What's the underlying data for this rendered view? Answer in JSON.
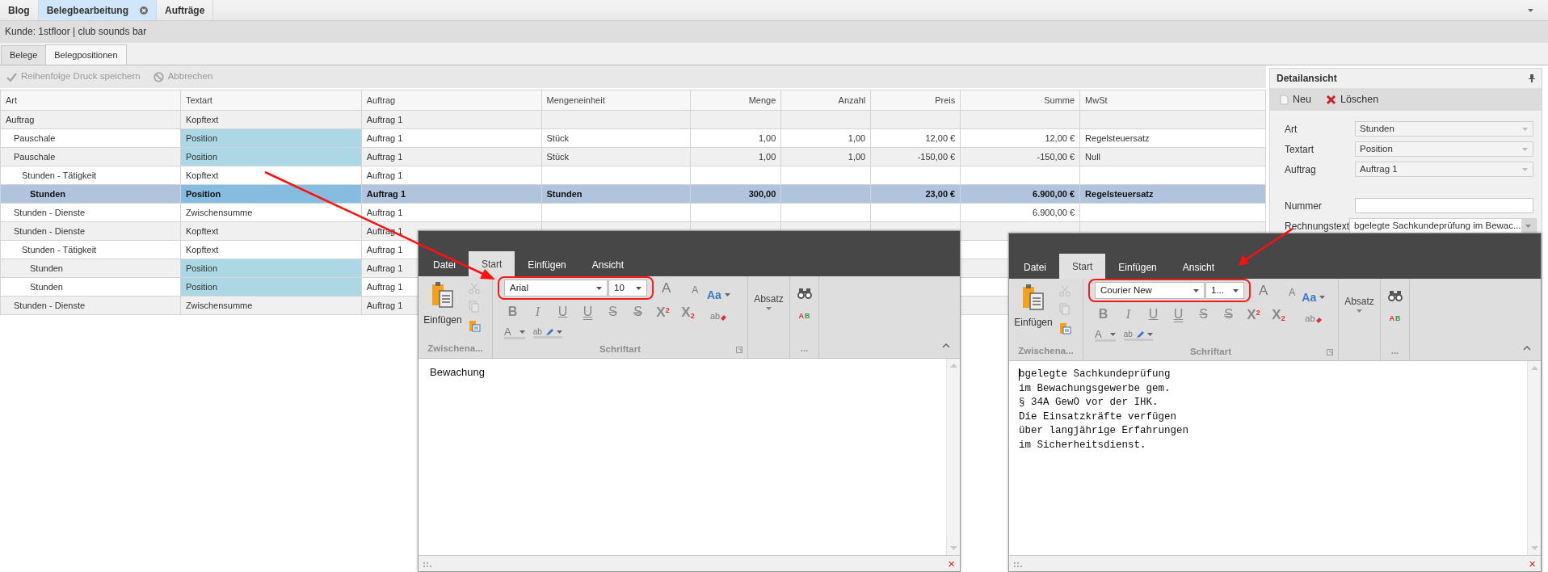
{
  "doc_tabs": [
    {
      "label": "Blog",
      "selected": false,
      "closable": false
    },
    {
      "label": "Belegbearbeitung",
      "selected": true,
      "closable": true
    },
    {
      "label": "Aufträge",
      "selected": false,
      "closable": false
    }
  ],
  "customer_bar": "Kunde: 1stfloor | club sounds bar",
  "sub_tabs": [
    {
      "label": "Belege",
      "selected": false
    },
    {
      "label": "Belegpositionen",
      "selected": true
    }
  ],
  "toolbar": [
    {
      "label": "Reihenfolge Druck speichern",
      "kind": "save",
      "disabled": true
    },
    {
      "label": "Abbrechen",
      "kind": "cancel",
      "disabled": true
    }
  ],
  "table": {
    "columns": [
      "Art",
      "Textart",
      "Auftrag",
      "Mengeneinheit",
      "Menge",
      "Anzahl",
      "Preis",
      "Summe",
      "MwSt"
    ],
    "rows": [
      {
        "cells": [
          "Auftrag",
          "Kopftext",
          "Auftrag 1"
        ],
        "selected": false,
        "highlight": false,
        "children": [
          {
            "cells": [
              "Pauschale",
              "Position",
              "Auftrag 1",
              "Stück",
              "1,00",
              "1,00",
              "12,00 €",
              "12,00 €",
              "Regelsteuersatz"
            ],
            "selected": false,
            "highlight": true
          },
          {
            "cells": [
              "Pauschale",
              "Position",
              "Auftrag 1",
              "Stück",
              "1,00",
              "1,00",
              "-150,00 €",
              "-150,00 €",
              "Null"
            ],
            "selected": false,
            "highlight": true,
            "children": [
              {
                "cells": [
                  "Stunden - Tätigkeit",
                  "Kopftext",
                  "Auftrag 1"
                ],
                "selected": false,
                "highlight": false,
                "children": [
                  {
                    "cells": [
                      "Stunden",
                      "Position",
                      "Auftrag 1",
                      "Stunden",
                      "300,00",
                      null,
                      "23,00 €",
                      "6.900,00 €",
                      "Regelsteuersatz"
                    ],
                    "selected": true,
                    "highlight": true
                  }
                ]
              }
            ]
          },
          {
            "cells": [
              "Stunden - Dienste",
              "Zwischensumme",
              "Auftrag 1",
              null,
              null,
              null,
              null,
              "6.900,00 €"
            ],
            "selected": false,
            "highlight": false
          },
          {
            "cells": [
              "Stunden - Dienste",
              "Kopftext",
              "Auftrag 1"
            ],
            "selected": false,
            "highlight": false,
            "children": [
              {
                "cells": [
                  "Stunden - Tätigkeit",
                  "Kopftext",
                  "Auftrag 1"
                ],
                "selected": false,
                "highlight": false,
                "children": [
                  {
                    "cells": [
                      "Stunden",
                      "Position",
                      "Auftrag 1"
                    ],
                    "selected": false,
                    "highlight": true
                  },
                  {
                    "cells": [
                      "Stunden",
                      "Position",
                      "Auftrag 1"
                    ],
                    "selected": false,
                    "highlight": true
                  }
                ]
              }
            ]
          },
          {
            "cells": [
              "Stunden - Dienste",
              "Zwischensumme",
              "Auftrag 1"
            ],
            "selected": false,
            "highlight": false
          }
        ]
      }
    ]
  },
  "detail_panel": {
    "title": "Detailansicht",
    "buttons": [
      {
        "label": "Neu",
        "kind": "new"
      },
      {
        "label": "Löschen",
        "kind": "delete"
      }
    ],
    "field_groups": [
      [
        {
          "label": "Art",
          "kind": "combo",
          "value": "Stunden"
        },
        {
          "label": "Textart",
          "kind": "combo",
          "value": "Position"
        },
        {
          "label": "Auftrag",
          "kind": "combo",
          "value": "Auftrag 1"
        }
      ],
      [
        {
          "label": "Nummer",
          "kind": "text"
        },
        {
          "label": "Rechnungstext",
          "kind": "combo-button",
          "value": "bgelegte Sachkundeprüfung im Bewac..."
        }
      ]
    ]
  },
  "editors": [
    {
      "tabs": [
        {
          "label": "Datei",
          "selected": false
        },
        {
          "label": "Start",
          "selected": true
        },
        {
          "label": "Einfügen",
          "selected": false
        },
        {
          "label": "Ansicht",
          "selected": false
        }
      ],
      "clipboard": {
        "paste_label": "Einfügen",
        "group_label": "Zwischena..."
      },
      "font_group": {
        "font": "Arial",
        "size": "10",
        "group_label": "Schriftart",
        "tools": [
          {
            "kind": "grow",
            "label": "A"
          },
          {
            "kind": "shrink",
            "label": "A"
          },
          {
            "kind": "case",
            "label": "Aa"
          },
          {
            "kind": "clear",
            "label": "ab"
          },
          {
            "kind": "font-color",
            "label": "A"
          },
          {
            "kind": "highlight",
            "label": "ab"
          }
        ],
        "format_buttons": [
          {
            "kind": "bold",
            "label": "B"
          },
          {
            "kind": "italic",
            "label": "I"
          },
          {
            "kind": "underline",
            "label": "U"
          },
          {
            "kind": "double-underline",
            "label": "U"
          },
          {
            "kind": "strike",
            "label": "S"
          },
          {
            "kind": "double-strike",
            "label": "S"
          },
          {
            "kind": "script",
            "label": "X$^{2}$"
          },
          {
            "kind": "script",
            "label": "X$_{2}$"
          }
        ]
      },
      "paragraph_label": "Absatz",
      "editing_group": {
        "group_label": "...",
        "spell_labels": [
          "A",
          "B"
        ]
      },
      "monospace": false,
      "lines": [
        "Bewachung"
      ],
      "caret": false,
      "close_glyph": "×"
    },
    {
      "tabs": [
        {
          "label": "Datei",
          "selected": false
        },
        {
          "label": "Start",
          "selected": true
        },
        {
          "label": "Einfügen",
          "selected": false
        },
        {
          "label": "Ansicht",
          "selected": false
        }
      ],
      "clipboard": {
        "paste_label": "Einfügen",
        "group_label": "Zwischena..."
      },
      "font_group": {
        "font": "Courier New",
        "size": "1...",
        "group_label": "Schriftart",
        "tools": [
          {
            "kind": "grow",
            "label": "A"
          },
          {
            "kind": "shrink",
            "label": "A"
          },
          {
            "kind": "case",
            "label": "Aa"
          },
          {
            "kind": "clear",
            "label": "ab"
          },
          {
            "kind": "font-color",
            "label": "A"
          },
          {
            "kind": "highlight",
            "label": "ab"
          }
        ],
        "format_buttons": [
          {
            "kind": "bold",
            "label": "B"
          },
          {
            "kind": "italic",
            "label": "I"
          },
          {
            "kind": "underline",
            "label": "U"
          },
          {
            "kind": "double-underline",
            "label": "U"
          },
          {
            "kind": "strike",
            "label": "S"
          },
          {
            "kind": "double-strike",
            "label": "S"
          },
          {
            "kind": "script",
            "label": "X$^{2}$"
          },
          {
            "kind": "script",
            "label": "X$_{2}$"
          }
        ]
      },
      "paragraph_label": "Absatz",
      "editing_group": {
        "group_label": "...",
        "spell_labels": [
          "A",
          "B"
        ]
      },
      "monospace": true,
      "lines": [
        "bgelegte Sachkundeprüfung",
        "im Bewachungsgewerbe gem.",
        "§ 34A GewO vor der IHK.",
        "Die Einsatzkräfte verfügen",
        "über langjährige Erfahrungen",
        "im Sicherheitsdienst."
      ],
      "caret": true,
      "close_glyph": "×"
    }
  ]
}
